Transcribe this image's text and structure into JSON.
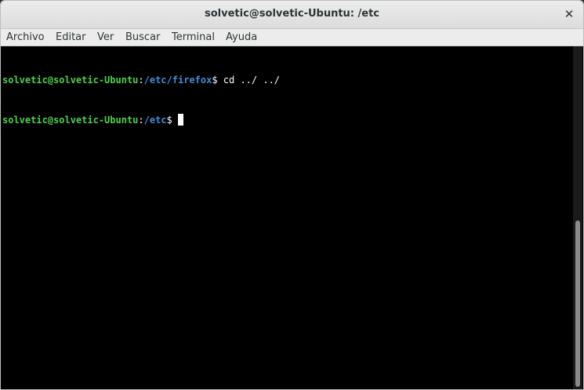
{
  "window": {
    "title": "solvetic@solvetic-Ubuntu: /etc",
    "close_glyph": "✕"
  },
  "menu": {
    "items": [
      "Archivo",
      "Editar",
      "Ver",
      "Buscar",
      "Terminal",
      "Ayuda"
    ]
  },
  "terminal": {
    "lines": [
      {
        "user": "solvetic@solvetic-Ubuntu",
        "sep": ":",
        "path": "/etc/firefox",
        "prompt": "$",
        "command": " cd ../ ../"
      },
      {
        "user": "solvetic@solvetic-Ubuntu",
        "sep": ":",
        "path": "/etc",
        "prompt": "$",
        "command": " "
      }
    ]
  },
  "colors": {
    "user": "#4ed24a",
    "path": "#3f8ed8",
    "background": "#000000"
  }
}
